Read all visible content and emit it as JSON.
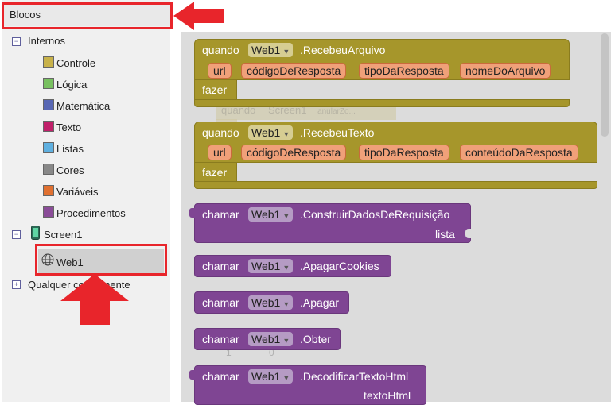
{
  "sidebar": {
    "header": "Blocos",
    "internos": {
      "label": "Internos",
      "toggle": "−",
      "items": [
        {
          "label": "Controle",
          "color": "#c8b24a"
        },
        {
          "label": "Lógica",
          "color": "#78c060"
        },
        {
          "label": "Matemática",
          "color": "#5867b4"
        },
        {
          "label": "Texto",
          "color": "#c0206a"
        },
        {
          "label": "Listas",
          "color": "#5fb0e0"
        },
        {
          "label": "Cores",
          "color": "#888888"
        },
        {
          "label": "Variáveis",
          "color": "#e07030"
        },
        {
          "label": "Procedimentos",
          "color": "#8a4c98"
        }
      ]
    },
    "screen": {
      "label": "Screen1",
      "toggle": "−"
    },
    "web_item": {
      "label": "Web1"
    },
    "any_component": {
      "label": "Qualquer componente",
      "toggle": "+"
    }
  },
  "workspace": {
    "blocks": [
      {
        "kind": "event",
        "keyword": "quando",
        "component": "Web1",
        "event": ".RecebeuArquivo",
        "params": [
          "url",
          "códigoDeResposta",
          "tipoDaResposta",
          "nomeDoArquivo"
        ],
        "do": "fazer"
      },
      {
        "kind": "event",
        "keyword": "quando",
        "component": "Web1",
        "event": ".RecebeuTexto",
        "params": [
          "url",
          "códigoDeResposta",
          "tipoDaResposta",
          "conteúdoDaResposta"
        ],
        "do": "fazer"
      },
      {
        "kind": "call",
        "keyword": "chamar",
        "component": "Web1",
        "method": ".ConstruirDadosDeRequisição",
        "arg": "lista"
      },
      {
        "kind": "call",
        "keyword": "chamar",
        "component": "Web1",
        "method": ".ApagarCookies"
      },
      {
        "kind": "call",
        "keyword": "chamar",
        "component": "Web1",
        "method": ".Apagar"
      },
      {
        "kind": "call",
        "keyword": "chamar",
        "component": "Web1",
        "method": ".Obter"
      },
      {
        "kind": "call",
        "keyword": "chamar",
        "component": "Web1",
        "method": ".DecodificarTextoHtml",
        "arg": "textoHtml"
      }
    ],
    "ghost": {
      "keyword": "quando",
      "component": "Screen1",
      "event": "anularZo..."
    },
    "ghost_counts": {
      "warnings": "1",
      "errors": "0"
    }
  },
  "colors": {
    "highlight": "#e8252b",
    "event_block": "#a6962b",
    "call_block": "#7f4593"
  }
}
